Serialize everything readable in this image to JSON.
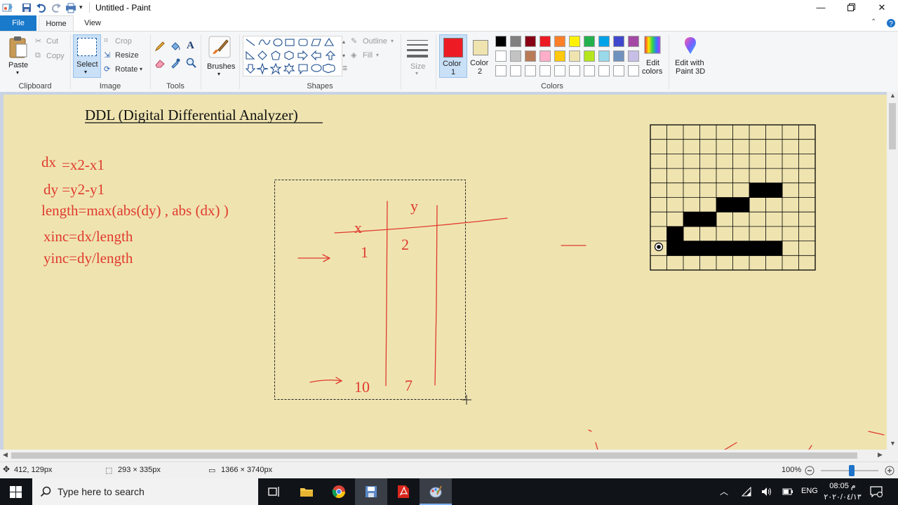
{
  "window": {
    "title": "Untitled - Paint"
  },
  "tabs": [
    {
      "label": "File"
    },
    {
      "label": "Home"
    },
    {
      "label": "View"
    }
  ],
  "ribbon": {
    "clipboard": {
      "paste": "Paste",
      "cut": "Cut",
      "copy": "Copy",
      "label": "Clipboard"
    },
    "image": {
      "select": "Select",
      "crop": "Crop",
      "resize": "Resize",
      "rotate": "Rotate",
      "label": "Image"
    },
    "tools": {
      "label": "Tools"
    },
    "brushes": {
      "label": "Brushes"
    },
    "shapes": {
      "outline": "Outline",
      "fill": "Fill",
      "label": "Shapes"
    },
    "size": {
      "label": "Size"
    },
    "color1": {
      "label": "Color 1",
      "line1": "Color",
      "line2": "1",
      "value": "#ed1c24"
    },
    "color2": {
      "label": "Color 2",
      "line1": "Color",
      "line2": "2",
      "value": "#efe4b0"
    },
    "colors_label": "Colors",
    "edit_colors": {
      "line1": "Edit",
      "line2": "colors"
    },
    "paint3d": {
      "line1": "Edit with",
      "line2": "Paint 3D"
    },
    "palette": [
      "#000000",
      "#7f7f7f",
      "#880015",
      "#ed1c24",
      "#ff7f27",
      "#fff200",
      "#22b14c",
      "#00a2e8",
      "#3f48cc",
      "#a349a4",
      "#ffffff",
      "#c3c3c3",
      "#b97a57",
      "#ffaec9",
      "#ffc90e",
      "#efe4b0",
      "#b5e61d",
      "#99d9ea",
      "#7092be",
      "#c8bfe7",
      "#ffffff",
      "#ffffff",
      "#ffffff",
      "#ffffff",
      "#ffffff",
      "#ffffff",
      "#ffffff",
      "#ffffff",
      "#ffffff",
      "#ffffff"
    ]
  },
  "canvas": {
    "heading": "DDL (Digital Differential Analyzer)",
    "formulas": [
      {
        "a": "dx",
        "b": "=x2-x1"
      },
      {
        "a": "dy =y2-y1"
      },
      {
        "a": "length=max(abs(dy) , abs (dx) )"
      },
      {
        "a": "xinc=dx/length"
      },
      {
        "a": "yinc=dy/length"
      }
    ],
    "handwriting": {
      "x": "x",
      "y": "y",
      "one": "1",
      "two": "2",
      "ten": "10",
      "seven": "7"
    },
    "background": "#efe4b0",
    "ink": "#e03a2e"
  },
  "statusbar": {
    "cursor": "412, 129px",
    "selection": "293 × 335px",
    "image_size": "1366 × 3740px",
    "zoom": "100%",
    "zoom_fraction": 0.54
  },
  "taskbar": {
    "search_placeholder": "Type here to search",
    "language": "ENG",
    "time": "08:05 م",
    "date": "٢٠٢٠/٠٤/١٣"
  }
}
